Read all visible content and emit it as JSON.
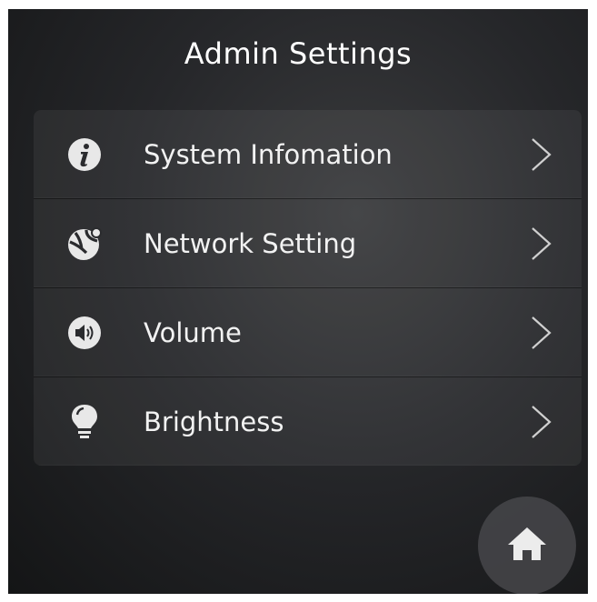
{
  "header": {
    "title": "Admin Settings"
  },
  "menu": {
    "items": [
      {
        "label": "System Infomation",
        "icon": "info-icon"
      },
      {
        "label": "Network Setting",
        "icon": "network-globe-icon"
      },
      {
        "label": "Volume",
        "icon": "speaker-icon"
      },
      {
        "label": "Brightness",
        "icon": "lightbulb-icon"
      }
    ]
  },
  "home": {
    "icon": "home-icon"
  },
  "colors": {
    "text": "#f2f2f2",
    "icon": "#e8e8e8",
    "chevron": "#d0d0d0"
  }
}
